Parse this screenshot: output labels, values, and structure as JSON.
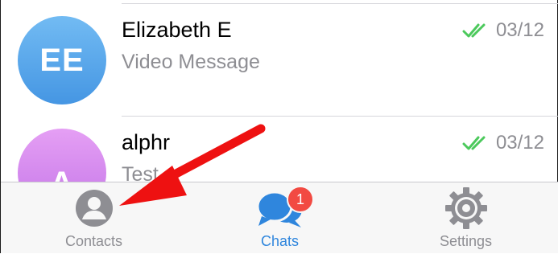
{
  "chats": [
    {
      "name": "Elizabeth E",
      "preview": "Video Message",
      "date": "03/12",
      "initials": "EE",
      "avatar_color": "#5aa8ec"
    },
    {
      "name": "alphr",
      "preview": "Test",
      "date": "03/12",
      "initials": "A",
      "avatar_color": "#d58bef"
    }
  ],
  "tabbar": {
    "contacts_label": "Contacts",
    "chats_label": "Chats",
    "settings_label": "Settings",
    "chats_badge": "1",
    "active_tab": "Chats"
  },
  "colors": {
    "accent": "#2f86dd",
    "badge": "#f24a42",
    "read_check": "#4cc95c",
    "annotation_arrow": "#ee1111"
  },
  "icons": {
    "read_status": "double-check-icon",
    "contacts": "person-circle-icon",
    "chats": "chat-bubbles-icon",
    "settings": "gear-icon"
  }
}
